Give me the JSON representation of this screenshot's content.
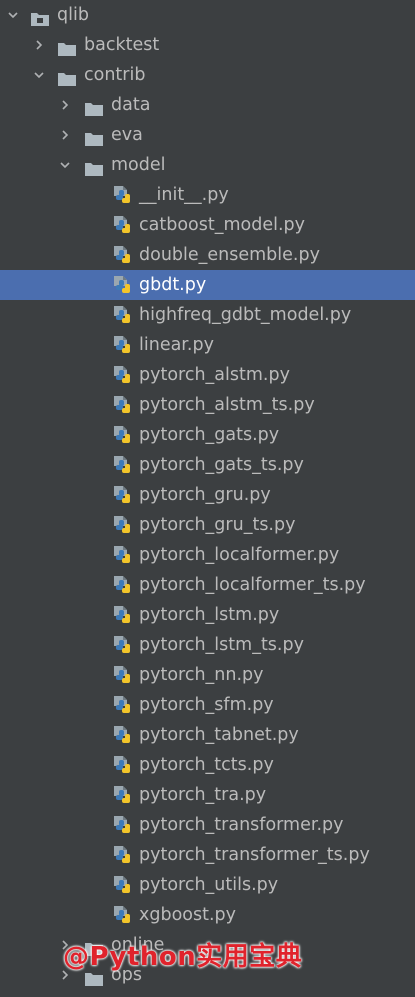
{
  "tree": {
    "root": {
      "label": "qlib",
      "expanded": true
    },
    "backtest": {
      "label": "backtest",
      "expanded": false
    },
    "contrib": {
      "label": "contrib",
      "expanded": true
    },
    "data": {
      "label": "data",
      "expanded": false
    },
    "eva": {
      "label": "eva",
      "expanded": false
    },
    "model": {
      "label": "model",
      "expanded": true
    },
    "files": [
      "__init__.py",
      "catboost_model.py",
      "double_ensemble.py",
      "gbdt.py",
      "highfreq_gdbt_model.py",
      "linear.py",
      "pytorch_alstm.py",
      "pytorch_alstm_ts.py",
      "pytorch_gats.py",
      "pytorch_gats_ts.py",
      "pytorch_gru.py",
      "pytorch_gru_ts.py",
      "pytorch_localformer.py",
      "pytorch_localformer_ts.py",
      "pytorch_lstm.py",
      "pytorch_lstm_ts.py",
      "pytorch_nn.py",
      "pytorch_sfm.py",
      "pytorch_tabnet.py",
      "pytorch_tcts.py",
      "pytorch_tra.py",
      "pytorch_transformer.py",
      "pytorch_transformer_ts.py",
      "pytorch_utils.py",
      "xgboost.py"
    ],
    "selected_file": "gbdt.py",
    "online": {
      "label": "online",
      "expanded": false
    },
    "ops": {
      "label": "ops",
      "expanded": false
    }
  },
  "watermark": "@Python实用宝典",
  "colors": {
    "background": "#3c3f41",
    "selection": "#4b6eaf",
    "text": "#bbbbbb",
    "folder": "#aeb9c0",
    "watermark": "#e0232c"
  },
  "icons": {
    "expanded": "chevron-down-icon",
    "collapsed": "chevron-right-icon",
    "folder": "folder-icon",
    "python_file": "python-file-icon"
  }
}
